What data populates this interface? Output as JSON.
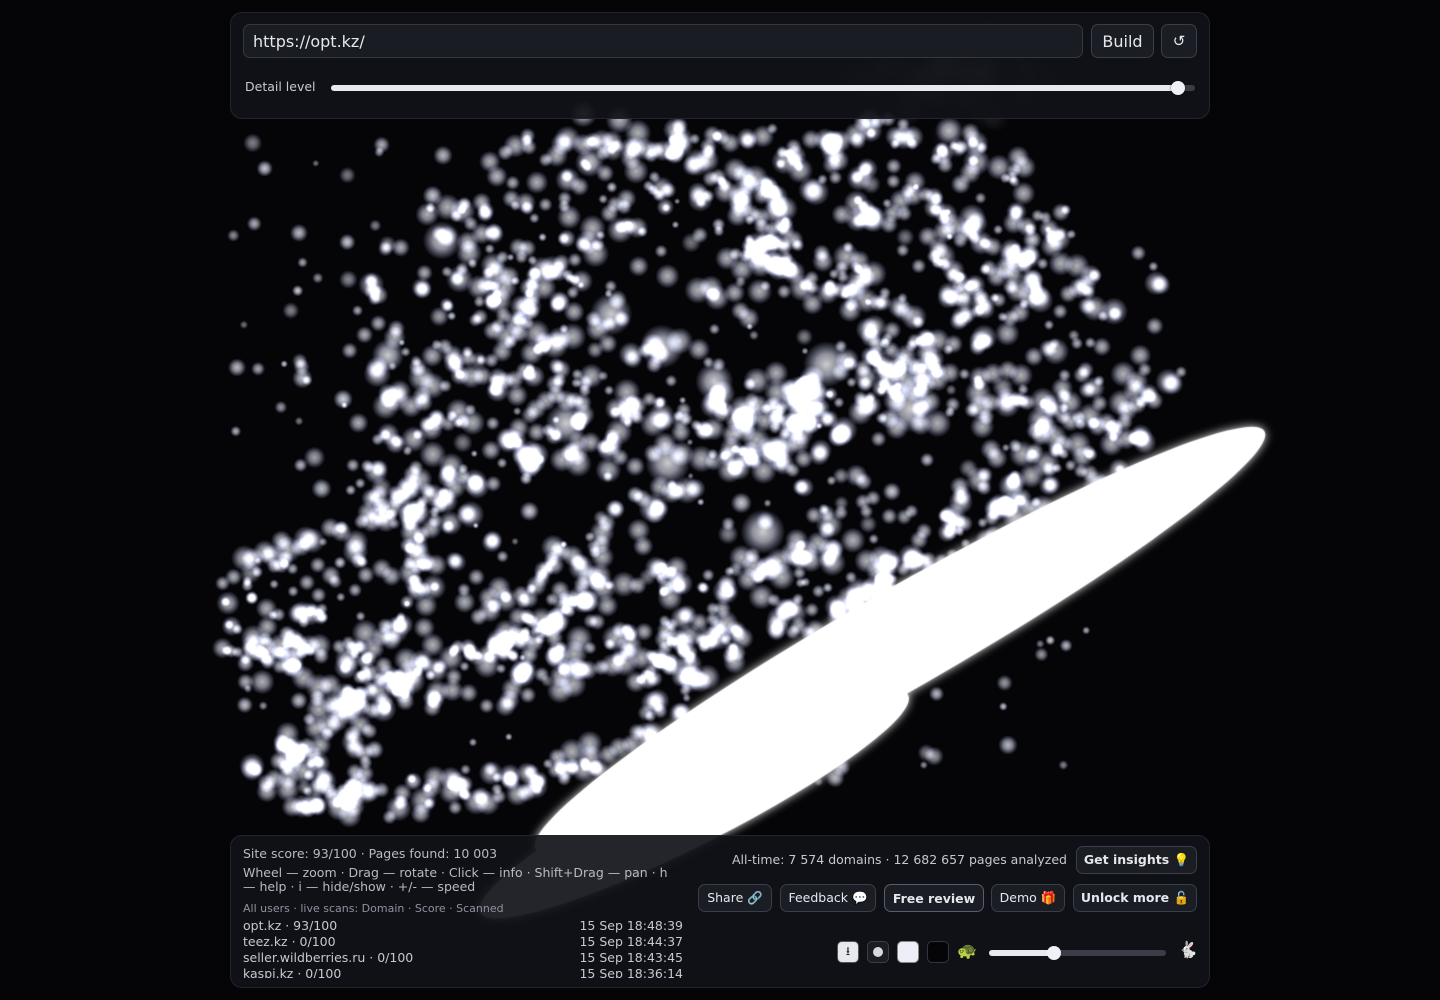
{
  "top_bar": {
    "url_value": "https://opt.kz/",
    "build_label": "Build",
    "reset_icon": "↺",
    "detail_label": "Detail level",
    "detail_level": 0.98
  },
  "status": {
    "score_line": "Site score: 93/100 · Pages found: 10 003",
    "help_line": "Wheel — zoom · Drag — rotate · Click — info · Shift+Drag — pan · h — help · i — hide/show · +/- — speed",
    "scans_header": "All users · live scans: Domain · Score · Scanned",
    "scans": [
      {
        "site": "opt.kz · 93/100",
        "time": "15 Sep 18:48:39"
      },
      {
        "site": "teez.kz · 0/100",
        "time": "15 Sep 18:44:37"
      },
      {
        "site": "seller.wildberries.ru · 0/100",
        "time": "15 Sep 18:43:45"
      },
      {
        "site": "kaspi.kz · 0/100",
        "time": "15 Sep 18:36:14"
      }
    ]
  },
  "actions": {
    "alltime": "All-time: 7 574 domains · 12 682 657 pages analyzed",
    "insights": "Get insights 💡",
    "share": "Share 🔗",
    "feedback": "Feedback 💬",
    "review": "Free review",
    "demo": "Demo 🎁",
    "unlock": "Unlock more 🔓"
  },
  "controls": {
    "download_icon": "⭳",
    "turtle_icon": "🐢",
    "rabbit_icon": "🐇",
    "speed_level": 0.37
  },
  "colors": {
    "background": "#050508",
    "particles": "#ffffff",
    "panel": "#111218"
  }
}
